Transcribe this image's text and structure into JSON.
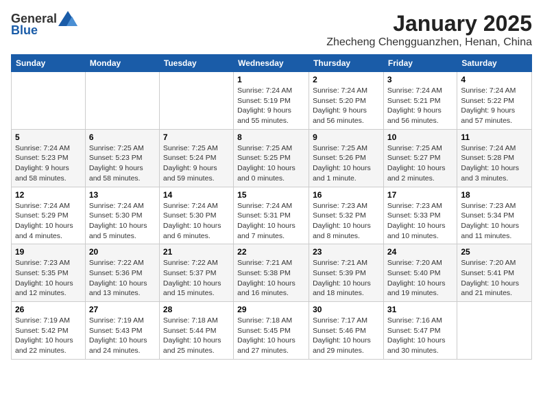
{
  "logo": {
    "general": "General",
    "blue": "Blue"
  },
  "title": "January 2025",
  "location": "Zhecheng Chengguanzhen, Henan, China",
  "days_of_week": [
    "Sunday",
    "Monday",
    "Tuesday",
    "Wednesday",
    "Thursday",
    "Friday",
    "Saturday"
  ],
  "weeks": [
    [
      {
        "day": "",
        "info": ""
      },
      {
        "day": "",
        "info": ""
      },
      {
        "day": "",
        "info": ""
      },
      {
        "day": "1",
        "info": "Sunrise: 7:24 AM\nSunset: 5:19 PM\nDaylight: 9 hours\nand 55 minutes."
      },
      {
        "day": "2",
        "info": "Sunrise: 7:24 AM\nSunset: 5:20 PM\nDaylight: 9 hours\nand 56 minutes."
      },
      {
        "day": "3",
        "info": "Sunrise: 7:24 AM\nSunset: 5:21 PM\nDaylight: 9 hours\nand 56 minutes."
      },
      {
        "day": "4",
        "info": "Sunrise: 7:24 AM\nSunset: 5:22 PM\nDaylight: 9 hours\nand 57 minutes."
      }
    ],
    [
      {
        "day": "5",
        "info": "Sunrise: 7:24 AM\nSunset: 5:23 PM\nDaylight: 9 hours\nand 58 minutes."
      },
      {
        "day": "6",
        "info": "Sunrise: 7:25 AM\nSunset: 5:23 PM\nDaylight: 9 hours\nand 58 minutes."
      },
      {
        "day": "7",
        "info": "Sunrise: 7:25 AM\nSunset: 5:24 PM\nDaylight: 9 hours\nand 59 minutes."
      },
      {
        "day": "8",
        "info": "Sunrise: 7:25 AM\nSunset: 5:25 PM\nDaylight: 10 hours\nand 0 minutes."
      },
      {
        "day": "9",
        "info": "Sunrise: 7:25 AM\nSunset: 5:26 PM\nDaylight: 10 hours\nand 1 minute."
      },
      {
        "day": "10",
        "info": "Sunrise: 7:25 AM\nSunset: 5:27 PM\nDaylight: 10 hours\nand 2 minutes."
      },
      {
        "day": "11",
        "info": "Sunrise: 7:24 AM\nSunset: 5:28 PM\nDaylight: 10 hours\nand 3 minutes."
      }
    ],
    [
      {
        "day": "12",
        "info": "Sunrise: 7:24 AM\nSunset: 5:29 PM\nDaylight: 10 hours\nand 4 minutes."
      },
      {
        "day": "13",
        "info": "Sunrise: 7:24 AM\nSunset: 5:30 PM\nDaylight: 10 hours\nand 5 minutes."
      },
      {
        "day": "14",
        "info": "Sunrise: 7:24 AM\nSunset: 5:30 PM\nDaylight: 10 hours\nand 6 minutes."
      },
      {
        "day": "15",
        "info": "Sunrise: 7:24 AM\nSunset: 5:31 PM\nDaylight: 10 hours\nand 7 minutes."
      },
      {
        "day": "16",
        "info": "Sunrise: 7:23 AM\nSunset: 5:32 PM\nDaylight: 10 hours\nand 8 minutes."
      },
      {
        "day": "17",
        "info": "Sunrise: 7:23 AM\nSunset: 5:33 PM\nDaylight: 10 hours\nand 10 minutes."
      },
      {
        "day": "18",
        "info": "Sunrise: 7:23 AM\nSunset: 5:34 PM\nDaylight: 10 hours\nand 11 minutes."
      }
    ],
    [
      {
        "day": "19",
        "info": "Sunrise: 7:23 AM\nSunset: 5:35 PM\nDaylight: 10 hours\nand 12 minutes."
      },
      {
        "day": "20",
        "info": "Sunrise: 7:22 AM\nSunset: 5:36 PM\nDaylight: 10 hours\nand 13 minutes."
      },
      {
        "day": "21",
        "info": "Sunrise: 7:22 AM\nSunset: 5:37 PM\nDaylight: 10 hours\nand 15 minutes."
      },
      {
        "day": "22",
        "info": "Sunrise: 7:21 AM\nSunset: 5:38 PM\nDaylight: 10 hours\nand 16 minutes."
      },
      {
        "day": "23",
        "info": "Sunrise: 7:21 AM\nSunset: 5:39 PM\nDaylight: 10 hours\nand 18 minutes."
      },
      {
        "day": "24",
        "info": "Sunrise: 7:20 AM\nSunset: 5:40 PM\nDaylight: 10 hours\nand 19 minutes."
      },
      {
        "day": "25",
        "info": "Sunrise: 7:20 AM\nSunset: 5:41 PM\nDaylight: 10 hours\nand 21 minutes."
      }
    ],
    [
      {
        "day": "26",
        "info": "Sunrise: 7:19 AM\nSunset: 5:42 PM\nDaylight: 10 hours\nand 22 minutes."
      },
      {
        "day": "27",
        "info": "Sunrise: 7:19 AM\nSunset: 5:43 PM\nDaylight: 10 hours\nand 24 minutes."
      },
      {
        "day": "28",
        "info": "Sunrise: 7:18 AM\nSunset: 5:44 PM\nDaylight: 10 hours\nand 25 minutes."
      },
      {
        "day": "29",
        "info": "Sunrise: 7:18 AM\nSunset: 5:45 PM\nDaylight: 10 hours\nand 27 minutes."
      },
      {
        "day": "30",
        "info": "Sunrise: 7:17 AM\nSunset: 5:46 PM\nDaylight: 10 hours\nand 29 minutes."
      },
      {
        "day": "31",
        "info": "Sunrise: 7:16 AM\nSunset: 5:47 PM\nDaylight: 10 hours\nand 30 minutes."
      },
      {
        "day": "",
        "info": ""
      }
    ]
  ]
}
